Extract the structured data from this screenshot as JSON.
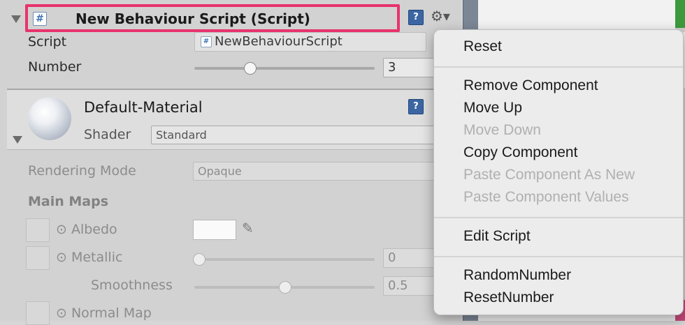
{
  "script_component": {
    "title": "New Behaviour Script (Script)",
    "icon_glyph": "#",
    "help_glyph": "?",
    "gear_glyph": "⚙▾",
    "script_label": "Script",
    "script_value": "NewBehaviourScript",
    "number_label": "Number",
    "number_value": "3",
    "number_slider_fraction": 0.33
  },
  "material": {
    "name": "Default-Material",
    "shader_label": "Shader",
    "shader_value": "Standard",
    "rendering_mode_label": "Rendering Mode",
    "rendering_mode_value": "Opaque",
    "main_maps_label": "Main Maps",
    "albedo_label": "⊙ Albedo",
    "metallic_label": "⊙ Metallic",
    "metallic_value": "0",
    "metallic_slider_fraction": 0.0,
    "smoothness_label": "Smoothness",
    "smoothness_value": "0.5",
    "smoothness_slider_fraction": 0.5,
    "normal_map_label": "⊙ Normal Map"
  },
  "context_menu": {
    "reset": "Reset",
    "remove_component": "Remove Component",
    "move_up": "Move Up",
    "move_down": "Move Down",
    "copy_component": "Copy Component",
    "paste_as_new": "Paste Component As New",
    "paste_values": "Paste Component Values",
    "edit_script": "Edit Script",
    "random_number": "RandomNumber",
    "reset_number": "ResetNumber"
  },
  "colors": {
    "highlight": "#e8336c",
    "panel_bg": "#d2d2d2",
    "menu_bg": "#ececec"
  }
}
